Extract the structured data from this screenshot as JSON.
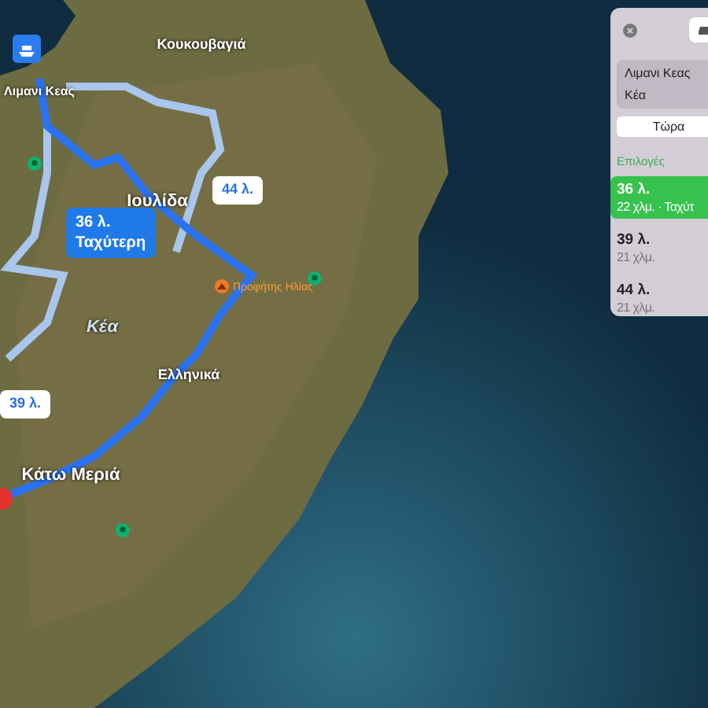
{
  "map": {
    "places": [
      {
        "name": "Κουκουβαγιά",
        "kind": "village"
      },
      {
        "name": "Λιμανι Κεας",
        "kind": "port"
      },
      {
        "name": "Ιουλίδα",
        "kind": "town"
      },
      {
        "name": "Κέα",
        "kind": "island"
      },
      {
        "name": "Ελληνικά",
        "kind": "village"
      },
      {
        "name": "Κάτω Μεριά",
        "kind": "town"
      }
    ],
    "route_labels": [
      {
        "time": "44 λ.",
        "selected": false
      },
      {
        "time": "36 λ.",
        "note": "Ταχύτερη",
        "selected": true
      },
      {
        "time": "39 λ.",
        "selected": false
      }
    ],
    "pois": [
      {
        "kind": "park"
      },
      {
        "kind": "park"
      },
      {
        "kind": "park"
      },
      {
        "kind": "peak",
        "label": "Προφήτης Ηλίας"
      }
    ]
  },
  "panel": {
    "from": "Λιμανι Κεας",
    "to": "Κέα",
    "time_button": "Τώρα",
    "options_heading": "Επιλογές",
    "options": [
      {
        "time": "36 λ.",
        "detail": "22 χλμ. · Ταχύτ",
        "selected": true
      },
      {
        "time": "39 λ.",
        "detail": "21 χλμ.",
        "selected": false
      },
      {
        "time": "44 λ.",
        "detail": "21 χλμ.",
        "selected": false
      }
    ]
  }
}
